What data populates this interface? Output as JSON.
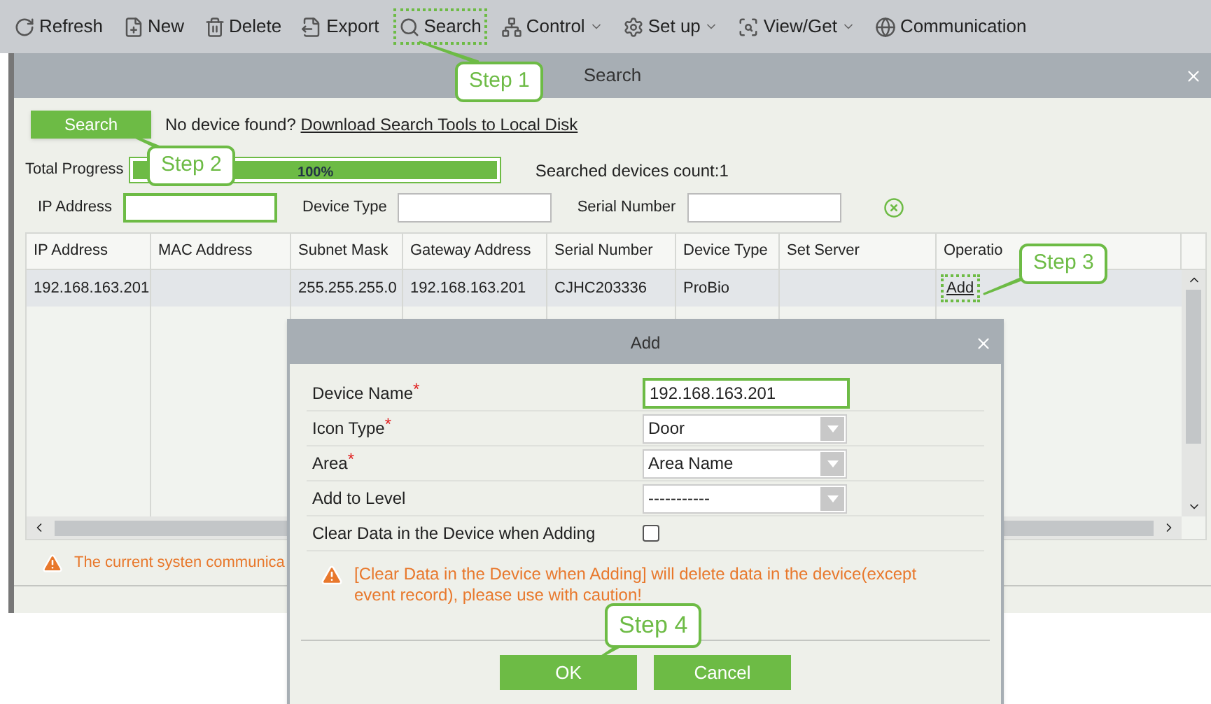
{
  "toolbar": {
    "items": [
      {
        "label": "Refresh",
        "dropdown": false,
        "highlighted": false
      },
      {
        "label": "New",
        "dropdown": false,
        "highlighted": false
      },
      {
        "label": "Delete",
        "dropdown": false,
        "highlighted": false
      },
      {
        "label": "Export",
        "dropdown": false,
        "highlighted": false
      },
      {
        "label": "Search",
        "dropdown": false,
        "highlighted": true
      },
      {
        "label": "Control",
        "dropdown": true,
        "highlighted": false
      },
      {
        "label": "Set up",
        "dropdown": true,
        "highlighted": false
      },
      {
        "label": "View/Get",
        "dropdown": true,
        "highlighted": false
      },
      {
        "label": "Communication",
        "dropdown": false,
        "highlighted": false
      }
    ]
  },
  "search_window": {
    "title": "Search",
    "search_button": "Search",
    "hint": "No device found?",
    "link": "Download Search Tools to Local Disk",
    "progress": {
      "label": "Total Progress",
      "level": 1,
      "reading": "100%"
    },
    "count": "Searched devices count:1",
    "filters": [
      {
        "label": "IP Address",
        "focused": true
      },
      {
        "label": "Device Type",
        "focused": false
      },
      {
        "label": "Serial Number",
        "focused": false
      }
    ],
    "table": {
      "columns": [
        "IP Address",
        "MAC Address",
        "Subnet Mask",
        "Gateway Address",
        "Serial Number",
        "Device Type",
        "Set Server",
        "Operatio"
      ],
      "rows": [
        {
          "cells": [
            "192.168.163.201",
            "",
            "255.255.255.0",
            "192.168.163.201",
            "CJHC203336",
            "ProBio",
            ""
          ],
          "action": "Add",
          "selected": true
        }
      ]
    },
    "warning": "The current systen communica"
  },
  "dialog": {
    "title": "Add",
    "required_mark": "*",
    "fields": [
      {
        "kind": "text",
        "label": "Device Name",
        "required": true,
        "value": "192.168.163.201",
        "focused": true
      },
      {
        "kind": "select",
        "label": "Icon Type",
        "required": true,
        "value": "Door"
      },
      {
        "kind": "select",
        "label": "Area",
        "required": true,
        "value": "Area Name"
      },
      {
        "kind": "select",
        "label": "Add to Level",
        "required": false,
        "value": "-----------"
      },
      {
        "kind": "checkbox",
        "label": "Clear Data in the Device when Adding",
        "required": false,
        "checked": false
      }
    ],
    "warning": "[Clear Data in the Device when Adding] will delete data in the device(except event record),  please use with caution!",
    "buttons": [
      "OK",
      "Cancel"
    ]
  },
  "callouts": [
    "Step 1",
    "Step 2",
    "Step 3",
    "Step 4"
  ]
}
